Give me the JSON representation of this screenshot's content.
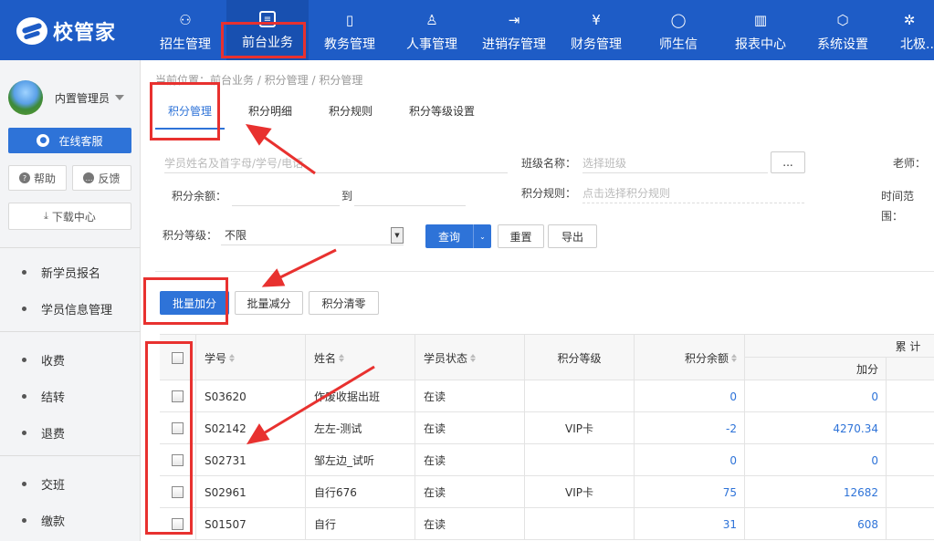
{
  "brand": {
    "name": "校管家"
  },
  "nav": [
    {
      "label": "招生管理",
      "icon": "user-plus-icon"
    },
    {
      "label": "前台业务",
      "icon": "desk-icon",
      "active": true
    },
    {
      "label": "教务管理",
      "icon": "book-icon"
    },
    {
      "label": "人事管理",
      "icon": "person-icon"
    },
    {
      "label": "进销存管理",
      "icon": "inventory-icon"
    },
    {
      "label": "财务管理",
      "icon": "finance-icon"
    },
    {
      "label": "师生信",
      "icon": "chat-icon"
    },
    {
      "label": "报表中心",
      "icon": "report-icon"
    },
    {
      "label": "系统设置",
      "icon": "settings-icon"
    },
    {
      "label": "北极...",
      "icon": "star-icon"
    }
  ],
  "sidebar": {
    "user_name": "内置管理员",
    "service_label": "在线客服",
    "help_label": "帮助",
    "feedback_label": "反馈",
    "download_label": "下载中心",
    "groups": [
      [
        "新学员报名",
        "学员信息管理"
      ],
      [
        "收费",
        "结转",
        "退费"
      ],
      [
        "交班",
        "缴款"
      ]
    ]
  },
  "breadcrumb": "当前位置：前台业务 / 积分管理 / 积分管理",
  "tabs": [
    "积分管理",
    "积分明细",
    "积分规则",
    "积分等级设置"
  ],
  "filters": {
    "student_placeholder": "学员姓名及首字母/学号/电话",
    "class_label": "班级名称：",
    "class_placeholder": "选择班级",
    "dots_label": "...",
    "teacher_label": "老师：",
    "balance_label": "积分余额：",
    "to_label": "到",
    "rule_label": "积分规则：",
    "rule_placeholder": "点击选择积分规则",
    "time_label": "时间范围：",
    "level_label": "积分等级：",
    "level_value": "不限",
    "query_label": "查询",
    "reset_label": "重置",
    "export_label": "导出"
  },
  "actions": {
    "batch_add": "批量加分",
    "batch_sub": "批量减分",
    "clear": "积分清零"
  },
  "table": {
    "headers": {
      "id": "学号",
      "name": "姓名",
      "status": "学员状态",
      "level": "积分等级",
      "balance": "积分余额",
      "cumulative": "累 计",
      "add": "加分"
    },
    "rows": [
      {
        "id": "S03620",
        "name": "作废收据出班",
        "status": "在读",
        "level": "",
        "balance": "0",
        "add": "0"
      },
      {
        "id": "S02142",
        "name": "左左-测试",
        "status": "在读",
        "level": "VIP卡",
        "balance": "-2",
        "add": "4270.34"
      },
      {
        "id": "S02731",
        "name": "邹左边_试听",
        "status": "在读",
        "level": "",
        "balance": "0",
        "add": "0"
      },
      {
        "id": "S02961",
        "name": "自行676",
        "status": "在读",
        "level": "VIP卡",
        "balance": "75",
        "add": "12682"
      },
      {
        "id": "S01507",
        "name": "自行",
        "status": "在读",
        "level": "",
        "balance": "31",
        "add": "608"
      }
    ]
  },
  "colors": {
    "nav_bg": "#1e5cc6",
    "primary": "#2e73d8",
    "highlight": "#e8312f"
  }
}
